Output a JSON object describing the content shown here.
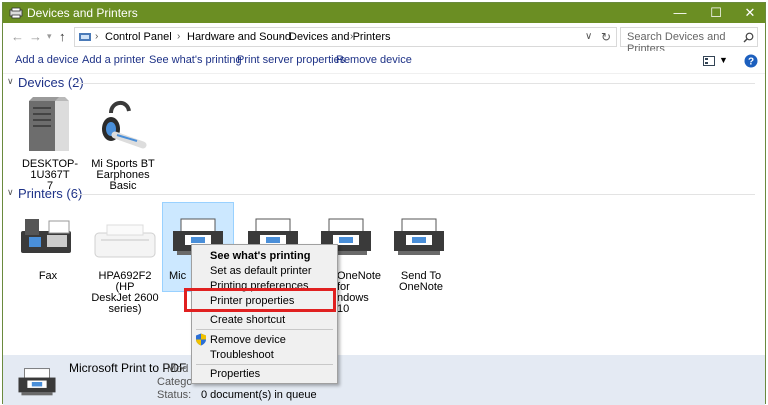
{
  "window": {
    "title": "Devices and Printers",
    "controls": {
      "minimize": "—",
      "maximize": "☐",
      "close": "✕"
    }
  },
  "address": {
    "back": "←",
    "forward": "→",
    "up": "↑",
    "crumbs": [
      "Control Panel",
      "Hardware and Sound",
      "Devices and Printers"
    ],
    "search_placeholder": "Search Devices and Printers"
  },
  "toolbar": {
    "items": [
      "Add a device",
      "Add a printer",
      "See what's printing",
      "Print server properties",
      "Remove device"
    ]
  },
  "devices": {
    "header": "Devices (2)",
    "items": [
      {
        "label": "DESKTOP-1U367T\n7",
        "icon": "computer-tower-icon"
      },
      {
        "label": "Mi Sports BT\nEarphones Basic",
        "icon": "bluetooth-headset-icon"
      }
    ]
  },
  "printers": {
    "header": "Printers (6)",
    "items": [
      {
        "label": "Fax",
        "icon": "fax-icon"
      },
      {
        "label": "HPA692F2 (HP\nDeskJet 2600\nseries)",
        "icon": "inkjet-printer-icon"
      },
      {
        "label": "Mic",
        "icon": "printer-icon"
      },
      {
        "label": "",
        "icon": "printer-icon"
      },
      {
        "label": "OneNote for\nndows 10",
        "icon": "printer-icon"
      },
      {
        "label": "Send To OneNote",
        "icon": "printer-icon"
      }
    ]
  },
  "status": {
    "name": "Microsoft Print to PDF",
    "model_label": "Mod",
    "category_label": "Catego",
    "status_label": "Status:",
    "status_value": "0 document(s) in queue"
  },
  "context_menu": {
    "items": [
      {
        "label": "See what's printing",
        "bold": true
      },
      {
        "label": "Set as default printer"
      },
      {
        "label": "Printing preferences"
      },
      {
        "label": "Printer properties"
      },
      {
        "label": "Create shortcut"
      },
      {
        "label": "Remove device"
      },
      {
        "label": "Troubleshoot"
      },
      {
        "label": "Properties"
      }
    ]
  },
  "colors": {
    "titlebar": "#6b8e23",
    "link": "#1e3287",
    "highlight": "#e02020",
    "selection": "#cce8ff"
  }
}
